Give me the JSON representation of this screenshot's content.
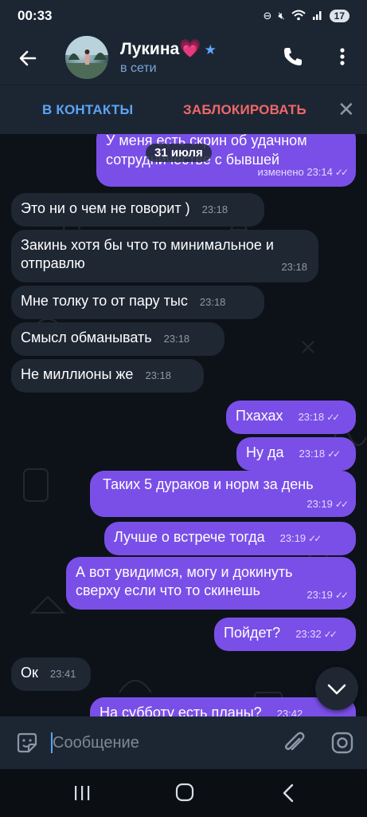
{
  "status_bar": {
    "time": "00:33",
    "battery": "17"
  },
  "header": {
    "contact_name": "Лукина",
    "name_emoji": "💗",
    "status": "в сети"
  },
  "action_bar": {
    "add_contact": "В КОНТАКТЫ",
    "block": "ЗАБЛОКИРОВАТЬ"
  },
  "chat": {
    "date": "31 июля",
    "messages": [
      {
        "dir": "out",
        "text": "У меня есть скрин об удачном сотрудничестве с бывшей",
        "meta": "изменено 23:14"
      },
      {
        "dir": "in",
        "text": "Это ни о чем не говорит )",
        "time": "23:18"
      },
      {
        "dir": "in",
        "text": "Закинь хотя бы что то минимальное и отправлю",
        "time": "23:18"
      },
      {
        "dir": "in",
        "text": "Мне толку то от пару тыс",
        "time": "23:18"
      },
      {
        "dir": "in",
        "text": "Смысл обманывать",
        "time": "23:18"
      },
      {
        "dir": "in",
        "text": "Не миллионы же",
        "time": "23:18"
      },
      {
        "dir": "out",
        "text": "Пхахах",
        "time": "23:18"
      },
      {
        "dir": "out",
        "text": "Ну да",
        "time": "23:18"
      },
      {
        "dir": "out",
        "text": "Таких 5 дураков и норм за день",
        "time": "23:19"
      },
      {
        "dir": "out",
        "text": "Лучше о встрече тогда",
        "time": "23:19"
      },
      {
        "dir": "out",
        "text": "А вот увидимся, могу и докинуть сверху если что то скинешь",
        "time": "23:19"
      },
      {
        "dir": "out",
        "text": "Пойдет?",
        "time": "23:32"
      },
      {
        "dir": "in",
        "text": "Ок",
        "time": "23:41"
      },
      {
        "dir": "out",
        "text": "На субботу есть планы?",
        "time": "23:42"
      }
    ]
  },
  "composer": {
    "placeholder": "Сообщение"
  },
  "colors": {
    "accent": "#5ba4f5",
    "outgoing_bubble": "#7a4fe8",
    "incoming_bubble": "#1f2733",
    "block_red": "#f0676a"
  }
}
